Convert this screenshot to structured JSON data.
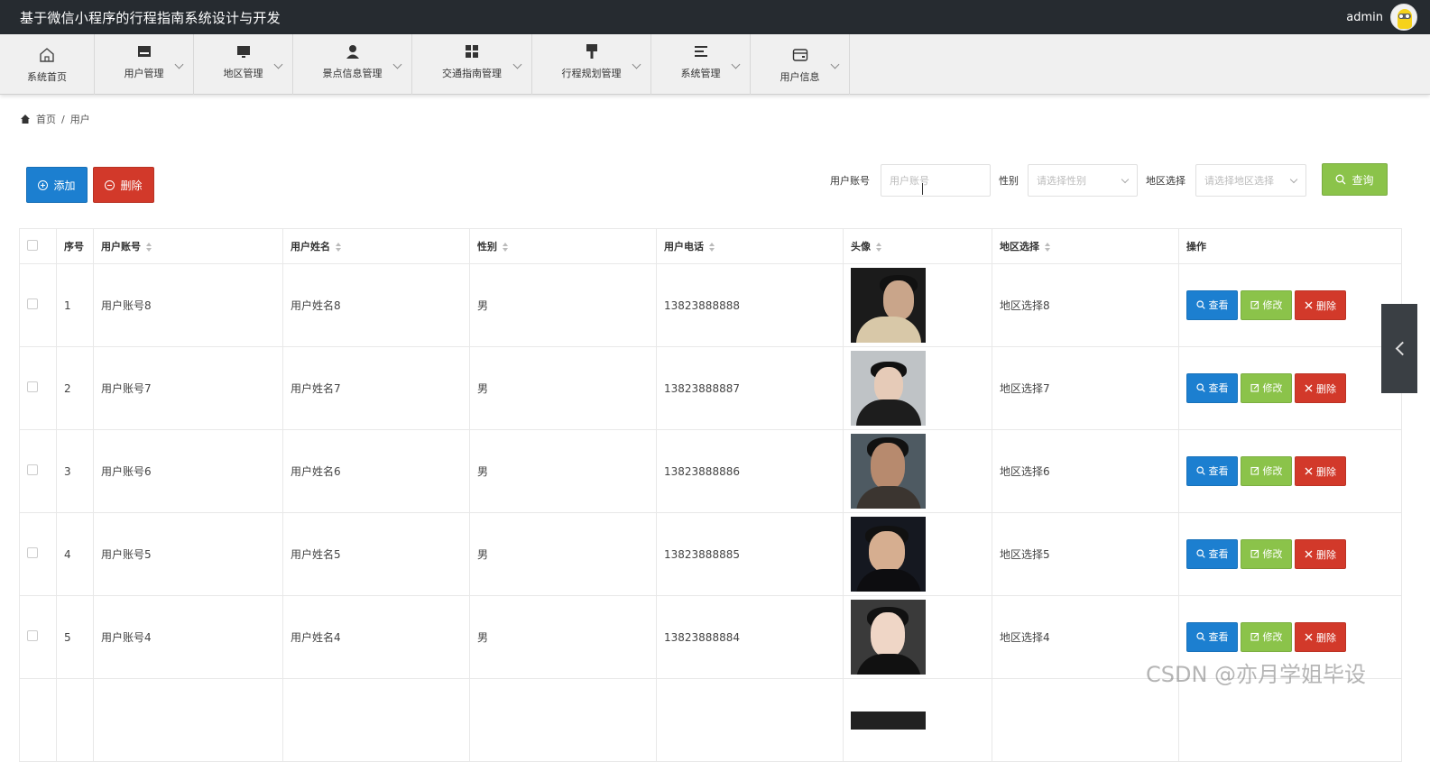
{
  "app": {
    "title": "基于微信小程序的行程指南系统设计与开发",
    "user": "admin"
  },
  "nav": [
    {
      "label": "系统首页",
      "icon": "home-icon"
    },
    {
      "label": "用户管理",
      "icon": "store-icon"
    },
    {
      "label": "地区管理",
      "icon": "monitor-icon"
    },
    {
      "label": "景点信息管理",
      "icon": "person-icon"
    },
    {
      "label": "交通指南管理",
      "icon": "grid-icon"
    },
    {
      "label": "行程规划管理",
      "icon": "brush-icon"
    },
    {
      "label": "系统管理",
      "icon": "menu-icon"
    },
    {
      "label": "用户信息",
      "icon": "wallet-icon"
    }
  ],
  "breadcrumb": {
    "home": "首页",
    "sep": "/",
    "current": "用户"
  },
  "toolbar": {
    "add": "添加",
    "delete": "删除",
    "query": "查询"
  },
  "filters": {
    "account_label": "用户账号",
    "account_placeholder": "用户账号",
    "gender_label": "性别",
    "gender_placeholder": "请选择性别",
    "region_label": "地区选择",
    "region_placeholder": "请选择地区选择"
  },
  "table": {
    "headers": [
      "序号",
      "用户账号",
      "用户姓名",
      "性别",
      "用户电话",
      "头像",
      "地区选择",
      "操作"
    ],
    "actions": {
      "view": "查看",
      "edit": "修改",
      "delete": "删除"
    },
    "rows": [
      {
        "idx": "1",
        "account": "用户账号8",
        "name": "用户姓名8",
        "gender": "男",
        "phone": "13823888888",
        "region": "地区选择8"
      },
      {
        "idx": "2",
        "account": "用户账号7",
        "name": "用户姓名7",
        "gender": "男",
        "phone": "13823888887",
        "region": "地区选择7"
      },
      {
        "idx": "3",
        "account": "用户账号6",
        "name": "用户姓名6",
        "gender": "男",
        "phone": "13823888886",
        "region": "地区选择6"
      },
      {
        "idx": "4",
        "account": "用户账号5",
        "name": "用户姓名5",
        "gender": "男",
        "phone": "13823888885",
        "region": "地区选择5"
      },
      {
        "idx": "5",
        "account": "用户账号4",
        "name": "用户姓名4",
        "gender": "男",
        "phone": "13823888884",
        "region": "地区选择4"
      }
    ]
  },
  "watermark": "CSDN @亦月学姐毕设",
  "colors": {
    "primary": "#1c7fd0",
    "success": "#8bc34a",
    "danger": "#d2392a",
    "topbar": "#262b30"
  }
}
